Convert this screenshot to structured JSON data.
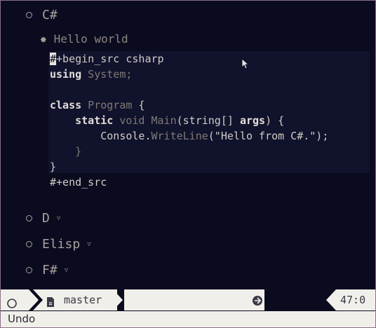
{
  "headings": {
    "csharp": "C#",
    "hello": "Hello world",
    "d": "D",
    "elisp": "Elisp",
    "fsharp": "F#"
  },
  "fold_indicator": "▽",
  "source": {
    "begin_cursor_char": "#",
    "begin_rest": "+begin_src csharp",
    "line_using_kw": "using",
    "line_using_rest": " System;",
    "line_class_kw": "class",
    "line_class_name": " Program",
    "line_class_brace": " {",
    "line_main_indent": "    ",
    "line_main_static": "static",
    "line_main_dim": " void Main",
    "line_main_paren": "(string[] ",
    "line_main_args": "args",
    "line_main_end": ") {",
    "line_console_indent": "        ",
    "line_console_obj": "Console.",
    "line_console_method": "WriteLine",
    "line_console_rest": "(\"Hello from C#.\");",
    "line_inner_close": "    }",
    "line_outer_close": "}",
    "end_src": "#+end_src"
  },
  "modeline": {
    "branch": "master",
    "position": "47:0",
    "icons": [
      "circle-icon",
      "file-icon",
      "branch-icon"
    ]
  },
  "echo": {
    "message": "Undo"
  },
  "colors": {
    "background": "#0b0b20",
    "src_background": "#11122c",
    "modeline": "#f1efe9"
  }
}
